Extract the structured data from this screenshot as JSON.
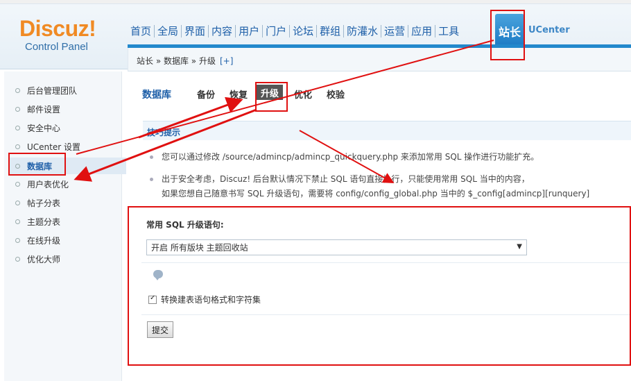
{
  "header": {
    "logo_text": "Discuz!",
    "logo_sub": "Control Panel",
    "nav": [
      "首页",
      "全局",
      "界面",
      "内容",
      "用户",
      "门户",
      "论坛",
      "群组",
      "防灌水",
      "运营",
      "应用",
      "工具"
    ],
    "nav_active": "站长",
    "nav_ucenter": "UCenter"
  },
  "breadcrumb": {
    "text": "站长 » 数据库 » 升级",
    "add": "[+]"
  },
  "sidebar": {
    "items": [
      {
        "label": "后台管理团队"
      },
      {
        "label": "邮件设置"
      },
      {
        "label": "安全中心"
      },
      {
        "label": "UCenter 设置"
      },
      {
        "label": "数据库"
      },
      {
        "label": "用户表优化"
      },
      {
        "label": "帖子分表"
      },
      {
        "label": "主题分表"
      },
      {
        "label": "在线升级"
      },
      {
        "label": "优化大师"
      }
    ],
    "active_index": 4
  },
  "main": {
    "title": "数据库",
    "tabs": [
      "备份",
      "恢复",
      "升级",
      "优化",
      "校验"
    ],
    "active_tab": "升级",
    "tips_title": "技巧提示",
    "tip1": "您可以通过修改 /source/admincp/admincp_quickquery.php 来添加常用 SQL 操作进行功能扩充。",
    "tip2a": "出于安全考虑，Discuz! 后台默认情况下禁止 SQL 语句直接执行，只能使用常用 SQL 当中的内容，",
    "tip2b": "如果您想自己随意书写 SQL 升级语句，需要将 config/config_global.php 当中的 $_config[admincp][runquery]"
  },
  "form": {
    "label": "常用 SQL 升级语句:",
    "select_value": "开启 所有版块 主题回收站",
    "checkbox_label": "转换建表语句格式和字符集",
    "checkbox_checked": true,
    "submit_label": "提交"
  },
  "colors": {
    "brand_blue": "#1e5fa8",
    "logo_orange": "#f08a24",
    "annotation_red": "#e01010"
  }
}
